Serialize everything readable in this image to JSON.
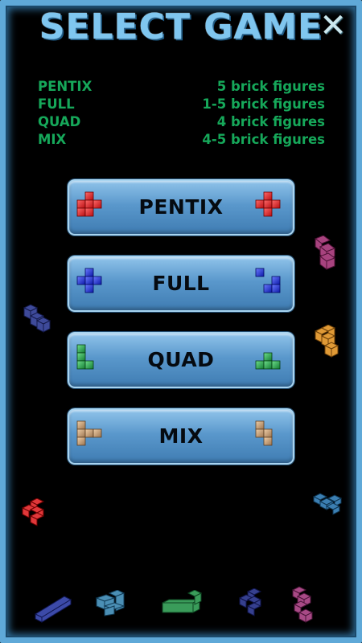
{
  "header": {
    "title": "SELECT GAME",
    "close_glyph": "✕"
  },
  "descriptions": [
    {
      "mode": "PENTIX",
      "info": "5 brick figures"
    },
    {
      "mode": "FULL",
      "info": "1-5 brick figures"
    },
    {
      "mode": "QUAD",
      "info": "4 brick figures"
    },
    {
      "mode": "MIX",
      "info": "4-5 brick figures"
    }
  ],
  "buttons": [
    {
      "label": "PENTIX",
      "color": "#e8262a"
    },
    {
      "label": "FULL",
      "color": "#2233d6"
    },
    {
      "label": "QUAD",
      "color": "#27a04a"
    },
    {
      "label": "MIX",
      "color": "#c6a079"
    }
  ],
  "colors": {
    "frame": "#5fa9d8",
    "title": "#7fc6ef",
    "description_text": "#16a85a",
    "button_blue": "#5a98cc",
    "close": "#cbe7ee"
  },
  "icons": {
    "close": "close-icon",
    "pentix": "red-plus-brick-icon",
    "full": "blue-brick-icon",
    "quad": "green-brick-icon",
    "mix": "tan-brick-icon"
  }
}
